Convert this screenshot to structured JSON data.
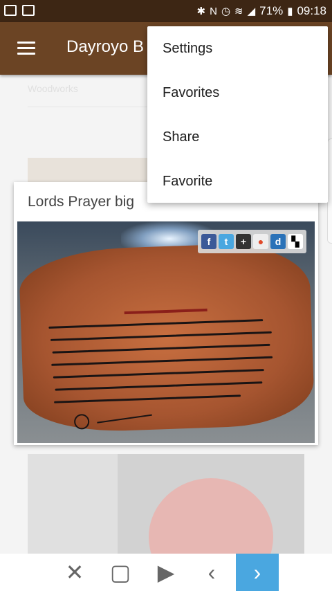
{
  "status_bar": {
    "battery_percent": "71%",
    "time": "09:18",
    "left_icons": [
      "gallery-icon",
      "mail-icon"
    ],
    "right_icons": [
      "bluetooth-icon",
      "nfc-icon",
      "alarm-icon",
      "wifi-icon",
      "signal-icon",
      "battery-icon"
    ]
  },
  "app_bar": {
    "title": "Dayroyo B",
    "menu_icon": "hamburger-menu-icon"
  },
  "content": {
    "breadcrumb": "Woodworks",
    "card": {
      "title": "Lords Prayer big",
      "share_icons": [
        "facebook-icon",
        "twitter-icon",
        "googleplus-icon",
        "reddit-icon",
        "digg-icon",
        "delicious-icon"
      ]
    }
  },
  "overflow_menu": {
    "items": [
      "Settings",
      "Favorites",
      "Share",
      "Favorite"
    ]
  },
  "bottom_nav": {
    "buttons": [
      {
        "name": "close",
        "glyph": "✕"
      },
      {
        "name": "stop",
        "glyph": "▢"
      },
      {
        "name": "play",
        "glyph": "▶"
      },
      {
        "name": "back",
        "glyph": "‹"
      },
      {
        "name": "forward",
        "glyph": "›"
      }
    ]
  }
}
